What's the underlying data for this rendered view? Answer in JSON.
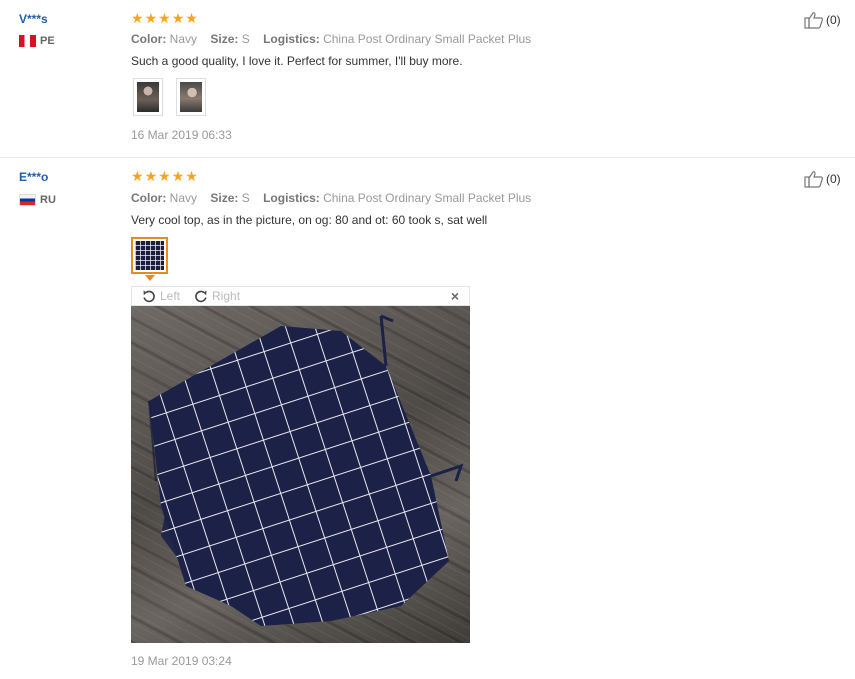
{
  "reviews": [
    {
      "user": "V***s",
      "country_code": "PE",
      "rating": 5,
      "attrs": {
        "color_label": "Color:",
        "color": "Navy",
        "size_label": "Size:",
        "size": "S",
        "logistics_label": "Logistics:",
        "logistics": "China Post Ordinary Small Packet Plus"
      },
      "text": "Such a good quality, I love it. Perfect for summer, I'll buy more.",
      "date": "16 Mar 2019 06:33",
      "helpful": "(0)"
    },
    {
      "user": "E***o",
      "country_code": "RU",
      "rating": 5,
      "attrs": {
        "color_label": "Color:",
        "color": "Navy",
        "size_label": "Size:",
        "size": "S",
        "logistics_label": "Logistics:",
        "logistics": "China Post Ordinary Small Packet Plus"
      },
      "text": "Very cool top, as in the picture, on og: 80 and ot: 60 took s, sat well",
      "date": "19 Mar 2019 03:24",
      "helpful": "(0)"
    }
  ],
  "viewer": {
    "rotate_left": "Left",
    "rotate_right": "Right",
    "close": "×"
  },
  "colors": {
    "star": "#f7a51c",
    "user": "#1e5fa8",
    "selected_border": "#e58b1f"
  },
  "icons": {
    "helpful": "thumbs-up-icon",
    "rotate_left": "rotate-left-icon",
    "rotate_right": "rotate-right-icon",
    "close": "close-icon"
  }
}
